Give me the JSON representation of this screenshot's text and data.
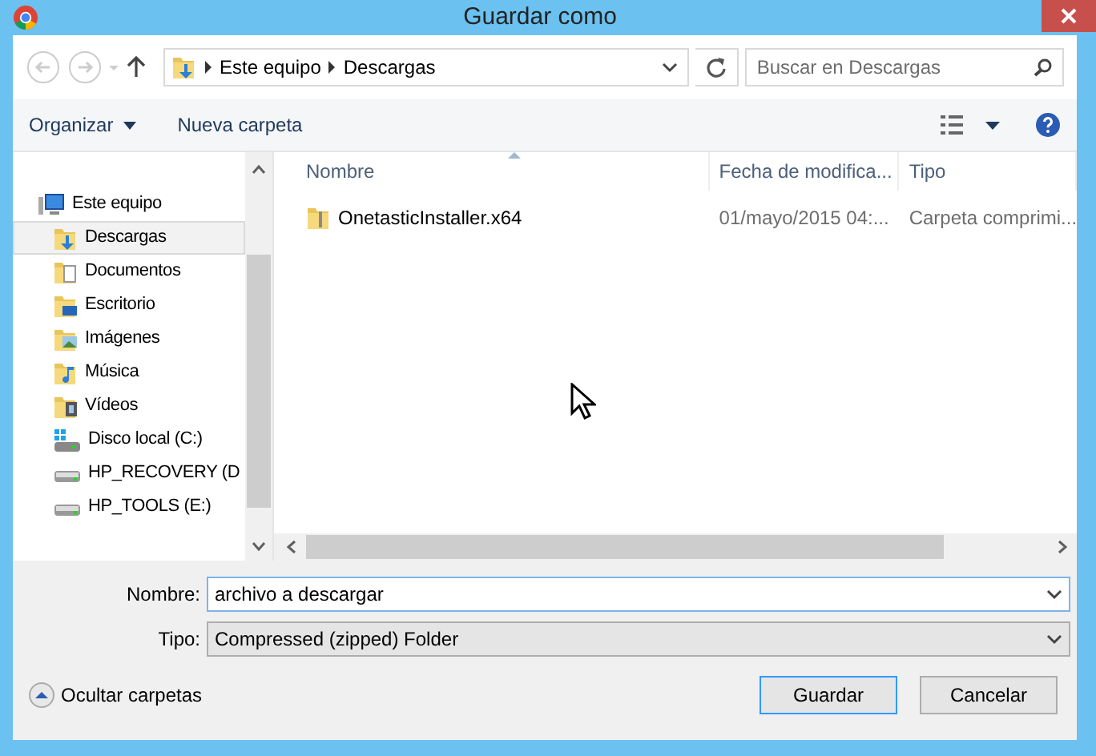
{
  "window": {
    "title": "Guardar como"
  },
  "address": {
    "path": [
      "Este equipo",
      "Descargas"
    ]
  },
  "search": {
    "placeholder": "Buscar en Descargas"
  },
  "toolbar": {
    "organize": "Organizar",
    "new_folder": "Nueva carpeta"
  },
  "sidebar": {
    "items": [
      {
        "label": "Este equipo",
        "kind": "computer",
        "selected": false,
        "children": [
          {
            "label": "Descargas",
            "kind": "downloads",
            "selected": true
          },
          {
            "label": "Documentos",
            "kind": "documents",
            "selected": false
          },
          {
            "label": "Escritorio",
            "kind": "desktop",
            "selected": false
          },
          {
            "label": "Imágenes",
            "kind": "pictures",
            "selected": false
          },
          {
            "label": "Música",
            "kind": "music",
            "selected": false
          },
          {
            "label": "Vídeos",
            "kind": "videos",
            "selected": false
          },
          {
            "label": "Disco local (C:)",
            "kind": "system-drive",
            "selected": false
          },
          {
            "label": "HP_RECOVERY (D",
            "kind": "drive",
            "selected": false
          },
          {
            "label": "HP_TOOLS (E:)",
            "kind": "drive",
            "selected": false
          }
        ]
      }
    ]
  },
  "table": {
    "columns": [
      {
        "label": "Nombre",
        "sorted": true
      },
      {
        "label": "Fecha de modifica...",
        "sorted": false
      },
      {
        "label": "Tipo",
        "sorted": false
      }
    ],
    "rows": [
      {
        "name": "OnetasticInstaller.x64",
        "date": "01/mayo/2015 04:...",
        "type": "Carpeta comprimi..."
      }
    ]
  },
  "form": {
    "name_label": "Nombre:",
    "name_value": "archivo a descargar",
    "type_label": "Tipo:",
    "type_value": "Compressed (zipped) Folder"
  },
  "footer": {
    "hide_folders": "Ocultar carpetas",
    "buttons": [
      {
        "label": "Guardar",
        "default": true
      },
      {
        "label": "Cancelar",
        "default": false
      }
    ]
  }
}
